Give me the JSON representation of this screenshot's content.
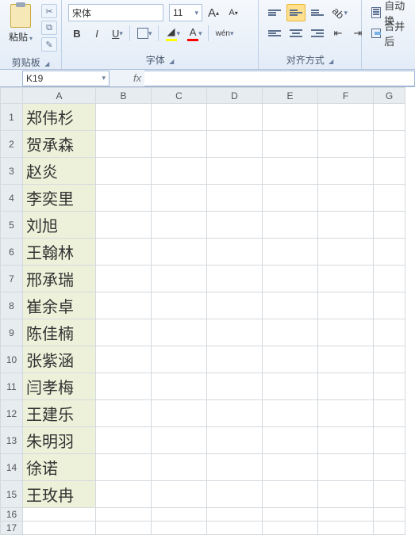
{
  "ribbon": {
    "clipboard": {
      "label": "剪贴板",
      "paste": "粘贴"
    },
    "font": {
      "label": "字体",
      "name": "宋体",
      "size": "11",
      "increase": "A",
      "decrease": "A",
      "bold": "B",
      "italic": "I",
      "underline": "U",
      "fontcolor": "A",
      "ruby": "wén"
    },
    "align": {
      "label": "对齐方式",
      "wrap": "自动换",
      "merge": "合并后"
    }
  },
  "namebox": "K19",
  "fx": "fx",
  "columns": [
    "A",
    "B",
    "C",
    "D",
    "E",
    "F",
    "G"
  ],
  "rows": [
    {
      "n": "1",
      "a": "郑伟杉"
    },
    {
      "n": "2",
      "a": "贺承森"
    },
    {
      "n": "3",
      "a": "赵炎"
    },
    {
      "n": "4",
      "a": "李奕里"
    },
    {
      "n": "5",
      "a": "刘旭"
    },
    {
      "n": "6",
      "a": "王翰林"
    },
    {
      "n": "7",
      "a": "邢承瑞"
    },
    {
      "n": "8",
      "a": "崔余卓"
    },
    {
      "n": "9",
      "a": "陈佳楠"
    },
    {
      "n": "10",
      "a": "张紫涵"
    },
    {
      "n": "11",
      "a": "闫孝梅"
    },
    {
      "n": "12",
      "a": "王建乐"
    },
    {
      "n": "13",
      "a": "朱明羽"
    },
    {
      "n": "14",
      "a": "徐诺"
    },
    {
      "n": "15",
      "a": "王玫冉"
    },
    {
      "n": "16",
      "a": ""
    },
    {
      "n": "17",
      "a": ""
    }
  ]
}
